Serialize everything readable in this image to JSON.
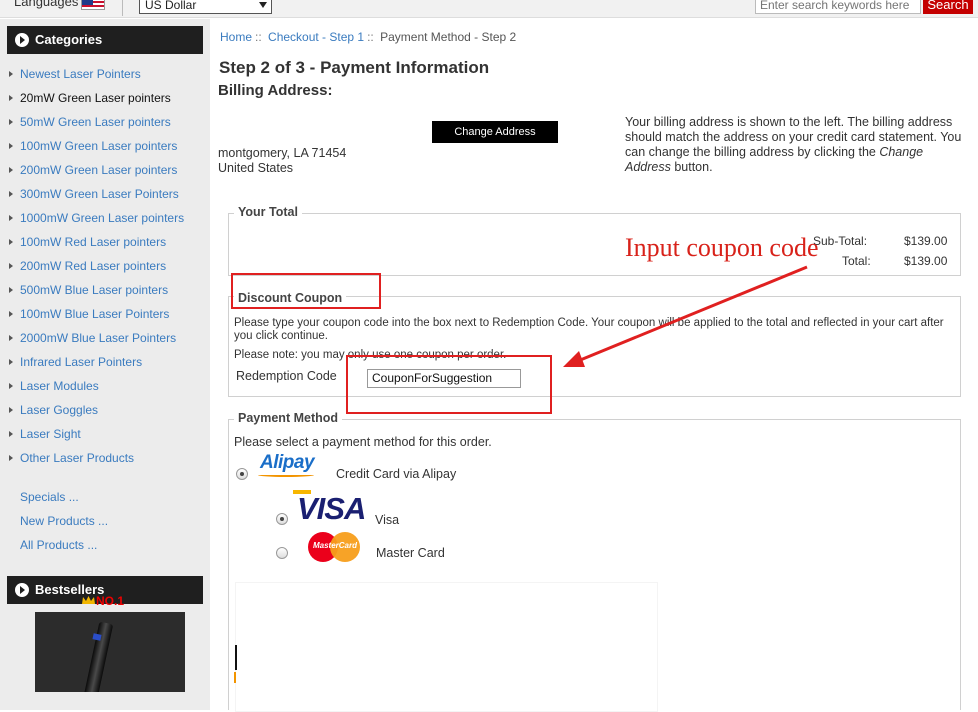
{
  "topbar": {
    "languages_label": "Languages",
    "currency_value": "US Dollar",
    "search_placeholder": "Enter search keywords here",
    "search_button": "Search"
  },
  "sidebar": {
    "categories_title": "Categories",
    "categories": [
      {
        "label": "Newest Laser Pointers"
      },
      {
        "label": "20mW Green Laser pointers"
      },
      {
        "label": "50mW Green Laser pointers"
      },
      {
        "label": "100mW Green Laser pointers"
      },
      {
        "label": "200mW Green Laser pointers"
      },
      {
        "label": "300mW Green Laser Pointers"
      },
      {
        "label": "1000mW Green Laser pointers"
      },
      {
        "label": "100mW Red Laser pointers"
      },
      {
        "label": "200mW Red Laser pointers"
      },
      {
        "label": "500mW Blue Laser pointers"
      },
      {
        "label": "100mW Blue Laser Pointers"
      },
      {
        "label": "2000mW Blue Laser Pointers"
      },
      {
        "label": "Infrared Laser Pointers"
      },
      {
        "label": "Laser Modules"
      },
      {
        "label": "Laser Goggles"
      },
      {
        "label": "Laser Sight"
      },
      {
        "label": "Other Laser Products"
      }
    ],
    "extra_links": [
      "Specials ...",
      "New Products ...",
      "All Products ..."
    ],
    "bestsellers_title": "Bestsellers",
    "bestseller_rank": "NO.1"
  },
  "breadcrumb": {
    "home": "Home",
    "checkout": "Checkout - Step 1",
    "current": "Payment Method - Step 2",
    "separator": "::"
  },
  "page": {
    "title": "Step 2 of 3 - Payment Information",
    "billing_title": "Billing Address:",
    "address_line1": "montgomery, LA 71454",
    "address_line2": "United States",
    "change_address_button": "Change Address",
    "billing_note_part1": "Your billing address is shown to the left. The billing address should match the address on your credit card statement. You can change the billing address by clicking the ",
    "billing_note_em": "Change Address",
    "billing_note_part2": " button."
  },
  "your_total": {
    "legend": "Your Total",
    "subtotal_label": "Sub-Total:",
    "subtotal_value": "$139.00",
    "total_label": "Total:",
    "total_value": "$139.00"
  },
  "discount_coupon": {
    "legend": "Discount Coupon",
    "instructions": "Please type your coupon code into the box next to Redemption Code. Your coupon will be applied to the total and reflected in your cart after you click continue.",
    "note": "Please note: you may only use one coupon per order.",
    "redemption_label": "Redemption Code",
    "redemption_value": "CouponForSuggestion"
  },
  "payment_method": {
    "legend": "Payment Method",
    "intro": "Please select a payment method for this order.",
    "alipay_logo": "Alipay",
    "alipay_label": "Credit Card via Alipay",
    "visa_logo": "VISA",
    "visa_label": "Visa",
    "mastercard_logo": "MasterCard",
    "mastercard_label": "Master Card"
  },
  "annotation": {
    "text": "Input coupon code",
    "color": "#d8221a"
  }
}
